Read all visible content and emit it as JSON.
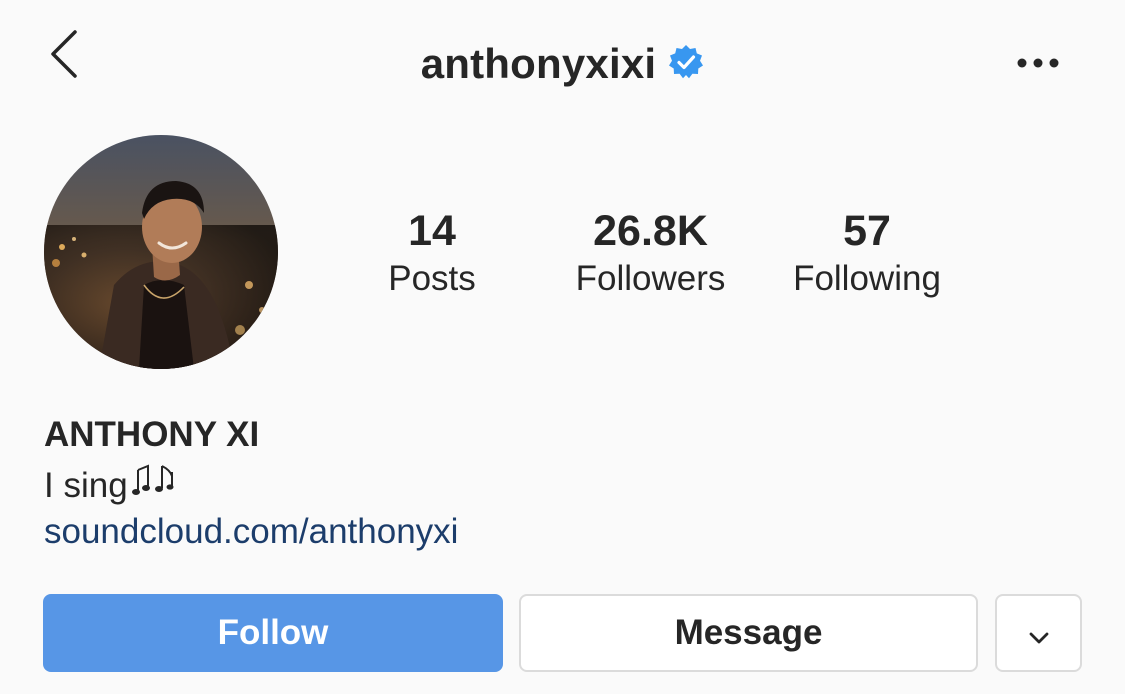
{
  "header": {
    "username": "anthonyxixi",
    "verified": true,
    "back_icon": "chevron-left-icon",
    "more_icon": "more-horizontal-icon"
  },
  "profile": {
    "stats": {
      "posts": {
        "value": "14",
        "label": "Posts"
      },
      "followers": {
        "value": "26.8K",
        "label": "Followers"
      },
      "following": {
        "value": "57",
        "label": "Following"
      }
    },
    "display_name": "ANTHONY XI",
    "bio": "I sing",
    "bio_emoji": "musical-notes",
    "link": "soundcloud.com/anthonyxi"
  },
  "actions": {
    "follow_label": "Follow",
    "message_label": "Message",
    "suggest_icon": "chevron-down-icon"
  },
  "colors": {
    "follow_button": "#5796e6",
    "verified_badge": "#3897f0",
    "link": "#1c3d6b",
    "background": "#fafafa"
  }
}
